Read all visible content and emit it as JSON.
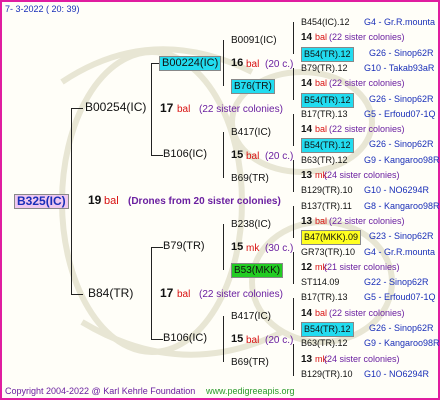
{
  "date": "7-  3-2022  ( 20: 39)",
  "copyright": "Copyright 2004-2022 @ Karl Kehrle Foundation",
  "site": "www.pedigreeapis.org",
  "colors": {
    "frame": "#e01da0",
    "cyan": "#22dcf0",
    "yellow": "#ffff20",
    "green": "#22cc22",
    "root_bg": "#f0c8f0"
  },
  "root": {
    "id": "B325(IC)",
    "num": "19",
    "unit": "bal",
    "note": "(Drones from 20 sister colonies)"
  },
  "g1": [
    {
      "id": "B00254(IC)",
      "num": "17",
      "unit": "bal",
      "note": "(22 sister colonies)"
    },
    {
      "id": "B84(TR)",
      "num": "17",
      "unit": "bal",
      "note": "(22 sister colonies)"
    }
  ],
  "g2": [
    {
      "id": "B00224(IC)",
      "num": "16",
      "unit": "bal",
      "note": "(20 c.)"
    },
    {
      "id": "B106(IC)",
      "num": "15",
      "unit": "bal",
      "note": "(20 c.)"
    },
    {
      "id": "B79(TR)",
      "num": "15",
      "unit": "mk",
      "note": "(30 c.)"
    },
    {
      "id": "B106(IC)",
      "num": "15",
      "unit": "bal",
      "note": "(20 c.)"
    }
  ],
  "g3": [
    "B0091(IC)",
    "B76(TR)",
    "B417(IC)",
    "B69(TR)",
    "B238(IC)",
    "B53(MKK)",
    "B417(IC)",
    "B69(TR)"
  ],
  "g4": [
    {
      "id": "B454(IC).12",
      "info": "G4 - Gr.R.mounta"
    },
    {
      "num": "14",
      "unit": "bal",
      "note": "(22 sister colonies)"
    },
    {
      "id": "B54(TR).12",
      "info": "G26 - Sinop62R"
    },
    {
      "id": "B79(TR).12",
      "info": "G10 - Takab93aR"
    },
    {
      "num": "14",
      "unit": "bal",
      "note": "(22 sister colonies)"
    },
    {
      "id": "B54(TR).12",
      "info": "G26 - Sinop62R"
    },
    {
      "id": "B17(TR).13",
      "info": "G5 - Erfoud07-1Q"
    },
    {
      "num": "14",
      "unit": "bal",
      "note": "(22 sister colonies)"
    },
    {
      "id": "B54(TR).12",
      "info": "G26 - Sinop62R"
    },
    {
      "id": "B63(TR).12",
      "info": "G9 - Kangaroo98R"
    },
    {
      "num": "13",
      "unit": "mk",
      "note": "(24 sister colonies)"
    },
    {
      "id": "B129(TR).10",
      "info": "G10 - NO6294R"
    },
    {
      "id": "B137(TR).11",
      "info": "G8 - Kangaroo98R"
    },
    {
      "num": "13",
      "unit": "bal",
      "note": "(22 sister colonies)"
    },
    {
      "id": "B47(MKK).09",
      "info": "G23 - Sinop62R"
    },
    {
      "id": "GR73(TR).10",
      "info": "G4 - Gr.R.mounta"
    },
    {
      "num": "12",
      "unit": "mk",
      "note": "(21 sister colonies)"
    },
    {
      "id": "ST114.09",
      "info": "G22 - Sinop62R"
    },
    {
      "id": "B17(TR).13",
      "info": "G5 - Erfoud07-1Q"
    },
    {
      "num": "14",
      "unit": "bal",
      "note": "(22 sister colonies)"
    },
    {
      "id": "B54(TR).12",
      "info": "G26 - Sinop62R"
    },
    {
      "id": "B63(TR).12",
      "info": "G9 - Kangaroo98R"
    },
    {
      "num": "13",
      "unit": "mk",
      "note": "(24 sister colonies)"
    },
    {
      "id": "B129(TR).10",
      "info": "G10 - NO6294R"
    }
  ]
}
